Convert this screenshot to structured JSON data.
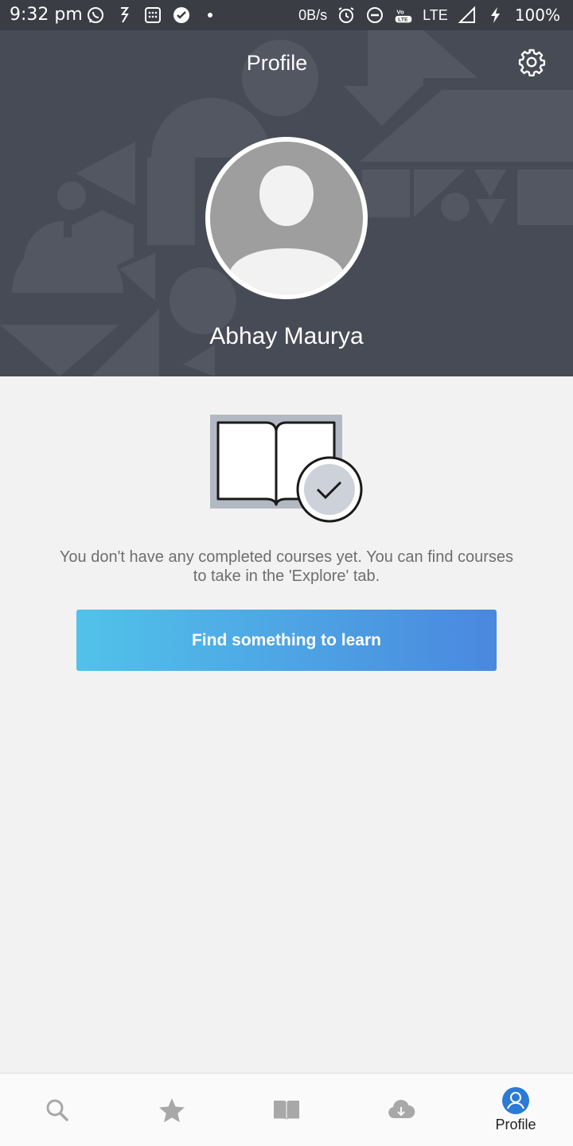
{
  "status_bar": {
    "time": "9:32 pm",
    "net_speed": "0B/s",
    "network": "LTE",
    "volte": "VoLTE",
    "battery": "100%"
  },
  "header": {
    "title": "Profile",
    "username": "Abhay Maurya",
    "background_color": "#474b56"
  },
  "main": {
    "empty_message": "You don't have any completed courses yet. You can find courses to take in the 'Explore' tab.",
    "cta_label": "Find something to learn",
    "cta_gradient": [
      "#51c2ea",
      "#4a88de"
    ]
  },
  "bottom_nav": {
    "items": [
      {
        "icon": "search-icon",
        "label": ""
      },
      {
        "icon": "star-icon",
        "label": ""
      },
      {
        "icon": "book-icon",
        "label": ""
      },
      {
        "icon": "download-icon",
        "label": ""
      },
      {
        "icon": "profile-icon",
        "label": "Profile",
        "active": true
      }
    ],
    "active_color": "#2a7ad6",
    "inactive_color": "#a8a8a8"
  }
}
